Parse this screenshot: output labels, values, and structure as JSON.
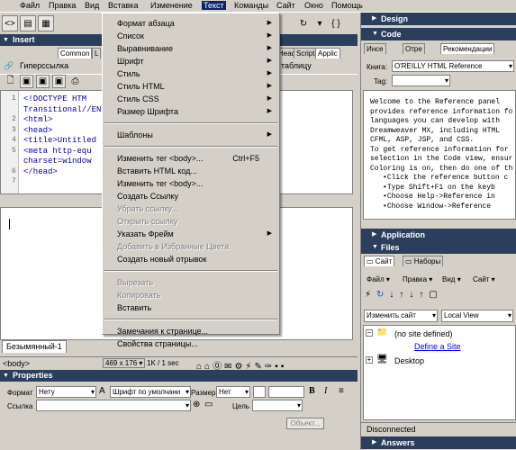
{
  "menubar": {
    "items": [
      "Файл",
      "Правка",
      "Вид",
      "Вставка",
      "Изменение",
      "Текст",
      "Команды",
      "Сайт",
      "Окно",
      "Помощь"
    ],
    "active_index": 5
  },
  "insert_panel": {
    "title": "Insert",
    "tabs": [
      "Common",
      "L",
      "Head",
      "Script",
      "Applic"
    ],
    "hyperlink_label": "Гиперссылка",
    "table_label": "таблицу"
  },
  "code": {
    "lines": [
      {
        "num": "1",
        "text": "<!DOCTYPE HTM"
      },
      {
        "num": "",
        "text": "Transitional//EN"
      },
      {
        "num": "2",
        "text": "<html>"
      },
      {
        "num": "3",
        "text": "<head>"
      },
      {
        "num": "4",
        "text": "<title>Untitled D"
      },
      {
        "num": "5",
        "text": "<meta http-equ"
      },
      {
        "num": "",
        "text": "charset=window"
      },
      {
        "num": "6",
        "text": "</head>"
      },
      {
        "num": "7",
        "text": ""
      }
    ],
    "tail_5": ");"
  },
  "doc_tab": "Безымянный-1",
  "status": {
    "tag": "<body>",
    "size": "469 x 176",
    "weight": "1K / 1 sec"
  },
  "properties": {
    "title": "Properties",
    "format_label": "Формат",
    "format_value": "Нету",
    "font_value": "Шрифт по умолчани",
    "size_label": "Размер",
    "size_value": "Нет",
    "link_label": "Ссылка",
    "target_label": "Цель",
    "object_button": "Объект..."
  },
  "context_menu": {
    "items": [
      {
        "label": "Формат абзаца",
        "submenu": true,
        "disabled": false
      },
      {
        "label": "Список",
        "submenu": true,
        "disabled": false
      },
      {
        "label": "Выравнивание",
        "submenu": true,
        "disabled": false
      },
      {
        "label": "Шрифт",
        "submenu": true,
        "disabled": false
      },
      {
        "label": "Стиль",
        "submenu": true,
        "disabled": false
      },
      {
        "label": "Стиль HTML",
        "submenu": true,
        "disabled": false
      },
      {
        "label": "Стиль CSS",
        "submenu": true,
        "disabled": false
      },
      {
        "label": "Размер Шрифта",
        "submenu": true,
        "disabled": false
      },
      {
        "sep": true
      },
      {
        "label": "Шаблоны",
        "submenu": true,
        "disabled": false
      },
      {
        "sep": true
      },
      {
        "label": "Изменить тег <body>...",
        "shortcut": "Ctrl+F5",
        "disabled": false
      },
      {
        "label": "Вставить HTML код...",
        "disabled": false
      },
      {
        "label": "Изменить тег <body>...",
        "disabled": false
      },
      {
        "label": "Создать Ссылку",
        "disabled": false
      },
      {
        "label": "Убрать ссылку...",
        "disabled": true
      },
      {
        "label": "Открыть ссылку",
        "disabled": true
      },
      {
        "label": "Указать Фрейм",
        "submenu": true,
        "disabled": false
      },
      {
        "label": "Добавить в Избранные Цвета",
        "disabled": true
      },
      {
        "label": "Создать новый отрывок",
        "disabled": false
      },
      {
        "sep": true
      },
      {
        "label": "Вырезать",
        "disabled": true
      },
      {
        "label": "Копировать",
        "disabled": true
      },
      {
        "label": "Вставить",
        "disabled": false
      },
      {
        "sep": true
      },
      {
        "label": "Замечания к странице...",
        "disabled": false
      },
      {
        "label": "Свойства страницы...",
        "disabled": false
      }
    ]
  },
  "right_panels": {
    "design": "Design",
    "code": "Code",
    "code_tabs": [
      "Инсе",
      "Отре",
      "Рекомендации"
    ],
    "book_label": "Книга:",
    "book_value": "O'REILLY HTML Reference",
    "tag_label": "Tag:",
    "reference_text": [
      "Welcome to the Reference panel",
      "provides reference information fo",
      "languages you can develop with",
      "Dreamweaver MX, including HTML",
      "CFML, ASP, JSP, and CSS.",
      "",
      "To get reference information for",
      "selection in the Code view, ensur",
      "Coloring is on, then do one of th"
    ],
    "reference_bullets": [
      "Click the reference button c",
      "Type Shift+F1 on the keyb",
      "Choose Help->Reference in",
      "Choose Window->Reference"
    ],
    "application": "Application",
    "files": "Files",
    "files_tabs": [
      "Сайт",
      "Наборы"
    ],
    "files_menu": [
      "Файл",
      "Правка",
      "Вид",
      "Сайт"
    ],
    "site_select": "Изменить сайт",
    "view_select": "Local View",
    "tree": {
      "no_site": "(no site defined)",
      "define_site": "Define a Site",
      "desktop": "Desktop"
    },
    "status": "Disconnected",
    "answers": "Answers"
  },
  "colors": {
    "panel_header": "#2b3e5c",
    "menu_highlight": "#0a246a",
    "link": "#0000ff"
  }
}
